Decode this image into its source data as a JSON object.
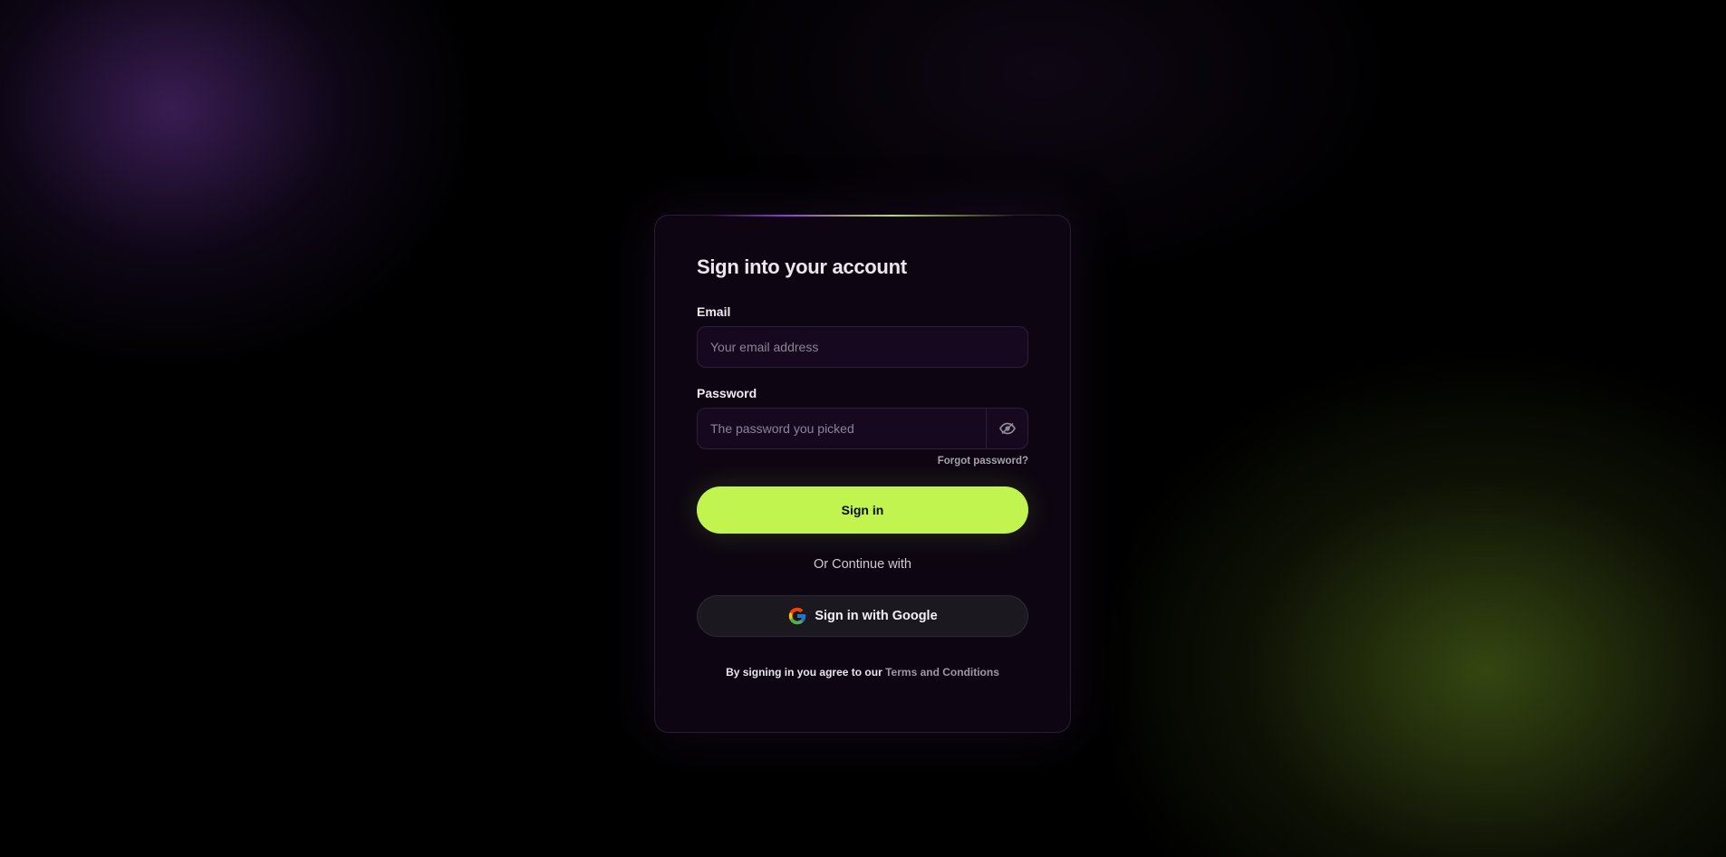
{
  "login": {
    "title": "Sign into your account",
    "email_label": "Email",
    "email_placeholder": "Your email address",
    "password_label": "Password",
    "password_placeholder": "The password you picked",
    "forgot_password": "Forgot password?",
    "sign_in_button": "Sign in",
    "divider_text": "Or Continue with",
    "google_button": "Sign in with Google",
    "terms_prefix": "By signing in you agree to our",
    "terms_link": "Terms and Conditions"
  },
  "icons": {
    "password_toggle": "eye-icon",
    "google": "google-icon"
  },
  "colors": {
    "accent": "#c1f44f",
    "card_background": "#0d0612",
    "input_background": "#16091f",
    "glow_purple": "#4c266e",
    "glow_green": "#3e5214"
  }
}
